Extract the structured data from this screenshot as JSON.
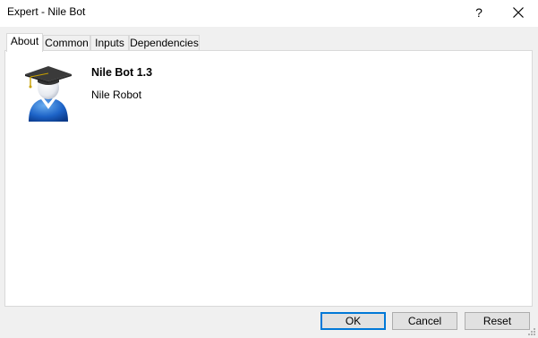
{
  "window": {
    "title": "Expert - Nile Bot",
    "help_symbol": "?",
    "close_icon": "close-icon"
  },
  "tabs": [
    {
      "label": "About",
      "active": true
    },
    {
      "label": "Common",
      "active": false
    },
    {
      "label": "Inputs",
      "active": false
    },
    {
      "label": "Dependencies",
      "active": false
    }
  ],
  "about": {
    "icon": "graduate-user-icon",
    "name": "Nile Bot 1.3",
    "description": "Nile Robot"
  },
  "buttons": {
    "ok": "OK",
    "cancel": "Cancel",
    "reset": "Reset"
  },
  "colors": {
    "accent": "#0078d7",
    "panel_bg": "#ffffff",
    "window_bg": "#f0f0f0"
  }
}
